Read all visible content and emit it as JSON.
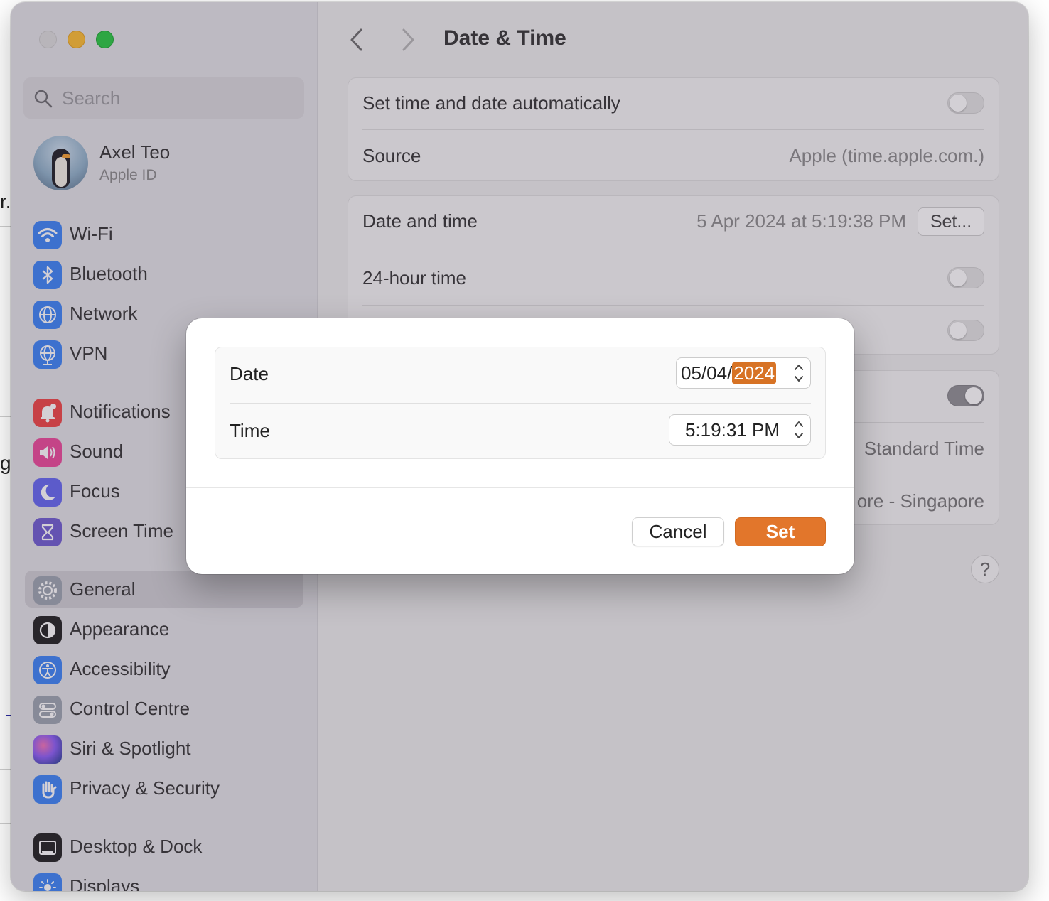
{
  "background_app": {
    "fragments": [
      "r.",
      "gi"
    ]
  },
  "sidebar": {
    "search_placeholder": "Search",
    "profile": {
      "name": "Axel Teo",
      "subtitle": "Apple ID"
    },
    "items": [
      {
        "label": "Wi-Fi",
        "icon": "wifi-icon",
        "color": "#3b82f6"
      },
      {
        "label": "Bluetooth",
        "icon": "bluetooth-icon",
        "color": "#3b82f6"
      },
      {
        "label": "Network",
        "icon": "globe-icon",
        "color": "#3b82f6"
      },
      {
        "label": "VPN",
        "icon": "vpn-globe-icon",
        "color": "#3b82f6"
      },
      {
        "label": "Notifications",
        "icon": "bell-icon",
        "color": "#ef4444"
      },
      {
        "label": "Sound",
        "icon": "speaker-icon",
        "color": "#ec4899"
      },
      {
        "label": "Focus",
        "icon": "moon-icon",
        "color": "#6366f1"
      },
      {
        "label": "Screen Time",
        "icon": "hourglass-icon",
        "color": "#6d5bd0"
      },
      {
        "label": "General",
        "icon": "gear-icon",
        "color": "#9ca3af",
        "selected": true
      },
      {
        "label": "Appearance",
        "icon": "appearance-icon",
        "color": "#1f1f1f"
      },
      {
        "label": "Accessibility",
        "icon": "accessibility-icon",
        "color": "#3b82f6"
      },
      {
        "label": "Control Centre",
        "icon": "control-centre-icon",
        "color": "#9ca3af"
      },
      {
        "label": "Siri & Spotlight",
        "icon": "siri-icon",
        "color": "#8b5cf6"
      },
      {
        "label": "Privacy & Security",
        "icon": "hand-icon",
        "color": "#3b82f6"
      },
      {
        "label": "Desktop & Dock",
        "icon": "dock-icon",
        "color": "#1f1f1f"
      },
      {
        "label": "Displays",
        "icon": "sun-icon",
        "color": "#3b82f6"
      }
    ]
  },
  "main": {
    "title": "Date & Time",
    "auto_row": {
      "label": "Set time and date automatically",
      "enabled": false
    },
    "source_row": {
      "label": "Source",
      "value": "Apple (time.apple.com.)"
    },
    "datetime_row": {
      "label": "Date and time",
      "value": "5 Apr 2024 at 5:19:38 PM",
      "button": "Set..."
    },
    "hour24_row": {
      "label": "24-hour time",
      "enabled": false
    },
    "timezone_rows": {
      "zone_partial": "Standard Time",
      "city_partial": "ore - Singapore"
    },
    "help": "?"
  },
  "dialog": {
    "date_label": "Date",
    "date_prefix": "05/04/",
    "date_year": "2024",
    "time_label": "Time",
    "time_value": "5:19:31 PM",
    "cancel": "Cancel",
    "confirm": "Set",
    "accent_color": "#e2762b"
  }
}
